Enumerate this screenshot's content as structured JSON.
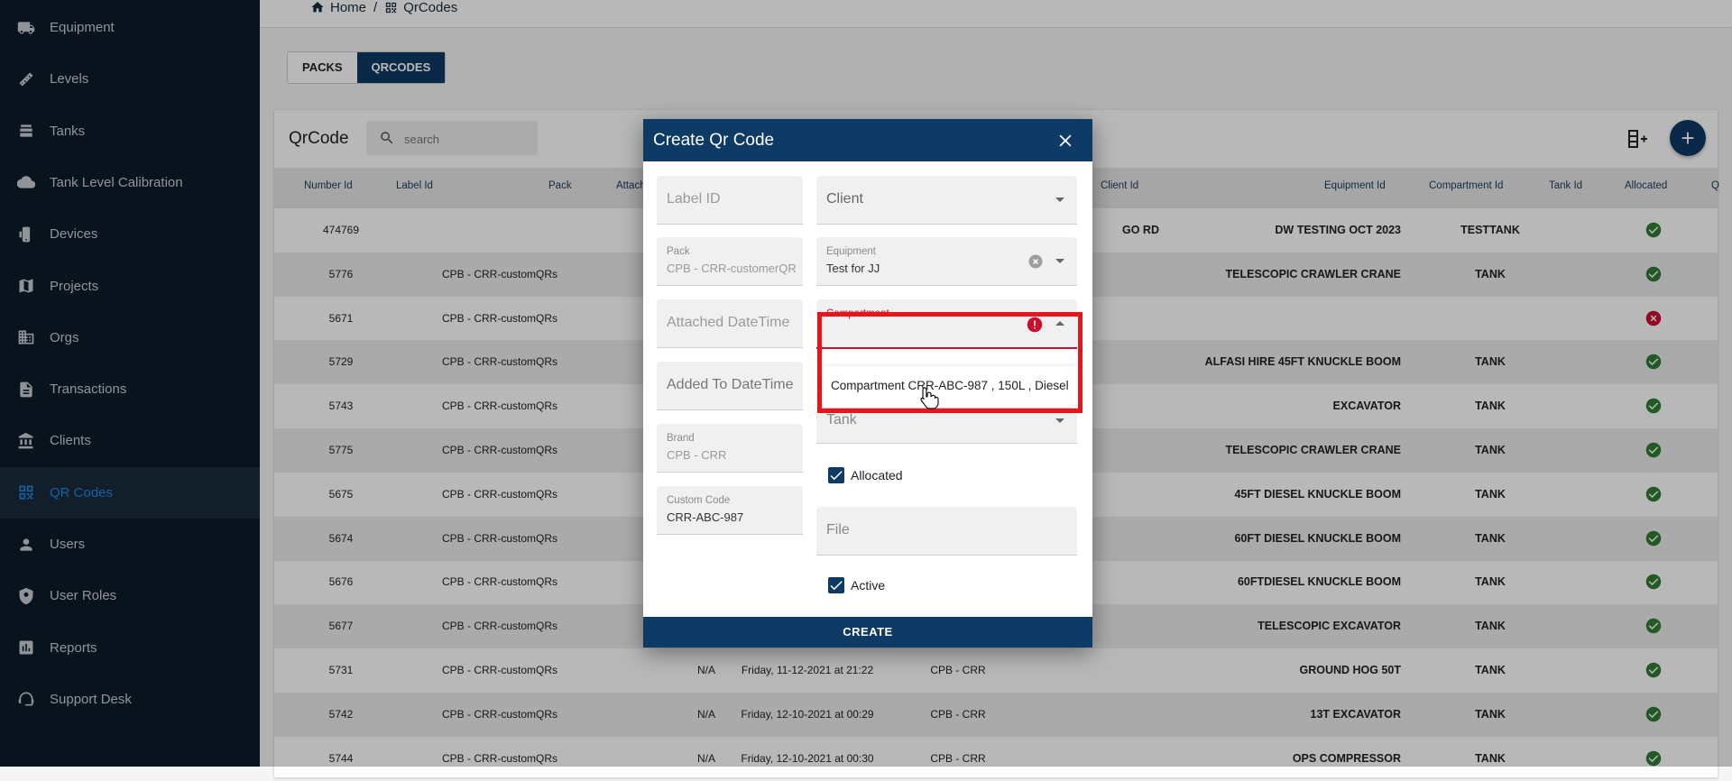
{
  "sidebar": {
    "items": [
      {
        "label": "Equipment",
        "icon": "truck-icon",
        "active": false
      },
      {
        "label": "Levels",
        "icon": "ruler-icon",
        "active": false
      },
      {
        "label": "Tanks",
        "icon": "tank-icon",
        "active": false
      },
      {
        "label": "Tank Level Calibration",
        "icon": "cloud-icon",
        "active": false
      },
      {
        "label": "Devices",
        "icon": "device-icon",
        "active": false
      },
      {
        "label": "Projects",
        "icon": "map-icon",
        "active": false
      },
      {
        "label": "Orgs",
        "icon": "building-icon",
        "active": false
      },
      {
        "label": "Transactions",
        "icon": "document-icon",
        "active": false
      },
      {
        "label": "Clients",
        "icon": "bank-icon",
        "active": false
      },
      {
        "label": "QR Codes",
        "icon": "qr-icon",
        "active": true
      },
      {
        "label": "Users",
        "icon": "user-icon",
        "active": false
      },
      {
        "label": "User Roles",
        "icon": "shield-icon",
        "active": false
      },
      {
        "label": "Reports",
        "icon": "report-icon",
        "active": false
      },
      {
        "label": "Support Desk",
        "icon": "support-icon",
        "active": false
      }
    ]
  },
  "breadcrumb": {
    "home": "Home",
    "separator": "/",
    "current": "QrCodes"
  },
  "tabs": [
    "PACKS",
    "QRCODES"
  ],
  "table": {
    "title": "QrCode",
    "search_placeholder": "search",
    "columns": {
      "number_id": "Number Id",
      "label_id": "Label Id",
      "pack": "Pack",
      "attached": "Attach",
      "client_id": "Client Id",
      "equipment_id": "Equipment Id",
      "compartment_id": "Compartment Id",
      "tank_id": "Tank Id",
      "allocated": "Allocated",
      "q": "Q"
    },
    "rows": [
      {
        "number": "474769",
        "pack": "",
        "attached": "",
        "date": "",
        "brand": "",
        "client": "GO RD",
        "equipment": "DW TESTING OCT 2023",
        "compartment": "TESTTANK",
        "allocated": true
      },
      {
        "number": "5776",
        "pack": "CPB - CRR-customQRs",
        "attached": "",
        "date": "",
        "brand": "",
        "client": "",
        "equipment": "TELESCOPIC CRAWLER CRANE",
        "compartment": "TANK",
        "allocated": true
      },
      {
        "number": "5671",
        "pack": "CPB - CRR-customQRs",
        "attached": "",
        "date": "",
        "brand": "",
        "client": "",
        "equipment": "",
        "compartment": "",
        "allocated": false
      },
      {
        "number": "5729",
        "pack": "CPB - CRR-customQRs",
        "attached": "",
        "date": "",
        "brand": "",
        "client": "",
        "equipment": "ALFASI HIRE 45FT KNUCKLE BOOM",
        "compartment": "TANK",
        "allocated": true
      },
      {
        "number": "5743",
        "pack": "CPB - CRR-customQRs",
        "attached": "",
        "date": "",
        "brand": "",
        "client": "",
        "equipment": "EXCAVATOR",
        "compartment": "TANK",
        "allocated": true
      },
      {
        "number": "5775",
        "pack": "CPB - CRR-customQRs",
        "attached": "",
        "date": "",
        "brand": "",
        "client": "",
        "equipment": "TELESCOPIC CRAWLER CRANE",
        "compartment": "TANK",
        "allocated": true
      },
      {
        "number": "5675",
        "pack": "CPB - CRR-customQRs",
        "attached": "",
        "date": "",
        "brand": "",
        "client": "",
        "equipment": "45FT DIESEL KNUCKLE BOOM",
        "compartment": "TANK",
        "allocated": true
      },
      {
        "number": "5674",
        "pack": "CPB - CRR-customQRs",
        "attached": "",
        "date": "",
        "brand": "",
        "client": "",
        "equipment": "60FT DIESEL KNUCKLE BOOM",
        "compartment": "TANK",
        "allocated": true
      },
      {
        "number": "5676",
        "pack": "CPB - CRR-customQRs",
        "attached": "",
        "date": "",
        "brand": "",
        "client": "",
        "equipment": "60FTDIESEL KNUCKLE BOOM",
        "compartment": "TANK",
        "allocated": true
      },
      {
        "number": "5677",
        "pack": "CPB - CRR-customQRs",
        "attached": "",
        "date": "",
        "brand": "",
        "client": "",
        "equipment": "TELESCOPIC EXCAVATOR",
        "compartment": "TANK",
        "allocated": true
      },
      {
        "number": "5731",
        "pack": "CPB - CRR-customQRs",
        "attached": "N/A",
        "date": "Friday, 11-12-2021 at 21:22",
        "brand": "CPB - CRR",
        "client": "",
        "equipment": "GROUND HOG 50T",
        "compartment": "TANK",
        "allocated": true
      },
      {
        "number": "5742",
        "pack": "CPB - CRR-customQRs",
        "attached": "N/A",
        "date": "Friday, 12-10-2021 at 00:29",
        "brand": "CPB - CRR",
        "client": "",
        "equipment": "13T EXCAVATOR",
        "compartment": "TANK",
        "allocated": true
      },
      {
        "number": "5744",
        "pack": "CPB - CRR-customQRs",
        "attached": "N/A",
        "date": "Friday, 12-10-2021 at 00:30",
        "brand": "CPB - CRR",
        "client": "",
        "equipment": "OPS COMPRESSOR",
        "compartment": "TANK",
        "allocated": true
      }
    ]
  },
  "dialog": {
    "title": "Create Qr Code",
    "label_id_placeholder": "Label ID",
    "pack": {
      "label": "Pack",
      "value": "CPB - CRR-customerQR"
    },
    "attached_placeholder": "Attached DateTime",
    "added_placeholder": "Added To DateTime",
    "brand": {
      "label": "Brand",
      "value": "CPB - CRR"
    },
    "custom_code": {
      "label": "Custom Code",
      "value": "CRR-ABC-987"
    },
    "client_placeholder": "Client",
    "equipment": {
      "label": "Equipment",
      "value": "Test for JJ"
    },
    "compartment_label": "Compartment",
    "compartment_option": "Compartment CRR-ABC-987 , 150L , Diesel",
    "tank_placeholder": "Tank",
    "allocated_label": "Allocated",
    "file_placeholder": "File",
    "active_label": "Active",
    "create_label": "CREATE"
  },
  "colors": {
    "primary": "#0e3a66",
    "sidebar": "#0d1b2a",
    "active": "#1e88e5",
    "error": "#c8102e",
    "highlight": "#e8141c",
    "success": "#2e7d32"
  }
}
